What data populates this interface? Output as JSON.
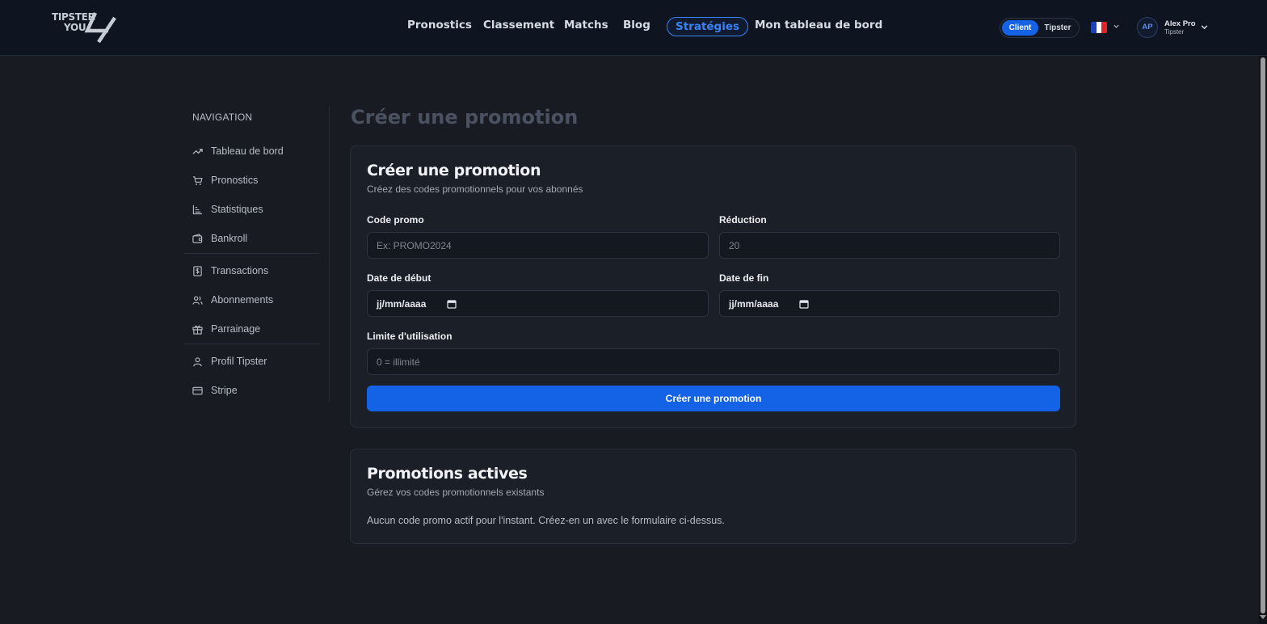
{
  "brand": {
    "line1": "TIPSTER",
    "line2": "YOU"
  },
  "nav": {
    "items": [
      {
        "label": "Pronostics"
      },
      {
        "label": "Classement"
      },
      {
        "label": "Matchs"
      },
      {
        "label": "Blog"
      },
      {
        "label": "Stratégies",
        "active": true
      },
      {
        "label": "Mon tableau de bord"
      }
    ]
  },
  "mode": {
    "client": "Client",
    "tipster": "Tipster",
    "selected": "Client"
  },
  "language": {
    "flag": "fr-flag-icon",
    "colors": [
      "#1f3fb5",
      "#ffffff",
      "#e0242b"
    ]
  },
  "user": {
    "initials": "AP",
    "name": "Alex Pro",
    "role": "Tipster"
  },
  "sidebar": {
    "heading": "NAVIGATION",
    "items": [
      {
        "label": "Tableau de bord",
        "icon": "trending-up-icon"
      },
      {
        "label": "Pronostics",
        "icon": "cart-icon"
      },
      {
        "label": "Statistiques",
        "icon": "bar-chart-icon"
      },
      {
        "label": "Bankroll",
        "icon": "wallet-icon"
      },
      {
        "label": "Transactions",
        "icon": "dollar-receipt-icon"
      },
      {
        "label": "Abonnements",
        "icon": "users-icon"
      },
      {
        "label": "Parrainage",
        "icon": "gift-icon"
      },
      {
        "label": "Profil Tipster",
        "icon": "user-icon"
      },
      {
        "label": "Stripe",
        "icon": "credit-card-icon"
      }
    ]
  },
  "page": {
    "title": "Créer une promotion"
  },
  "create_card": {
    "title": "Créer une promotion",
    "subtitle": "Créez des codes promotionnels pour vos abonnés",
    "fields": {
      "code": {
        "label": "Code promo",
        "placeholder": "Ex: PROMO2024"
      },
      "reduction": {
        "label": "Réduction",
        "placeholder": "20"
      },
      "start": {
        "label": "Date de début",
        "value": "jj/mm/aaaa"
      },
      "end": {
        "label": "Date de fin",
        "value": "jj/mm/aaaa"
      },
      "limit": {
        "label": "Limite d'utilisation",
        "placeholder": "0 = illimité"
      }
    },
    "submit_label": "Créer une promotion"
  },
  "active_card": {
    "title": "Promotions actives",
    "subtitle": "Gérez vos codes promotionnels existants",
    "empty_message": "Aucun code promo actif pour l'instant. Créez-en un avec le formulaire ci-dessus."
  },
  "colors": {
    "accent": "#1463e6",
    "background": "#181b22",
    "topbar": "#0f1520"
  }
}
